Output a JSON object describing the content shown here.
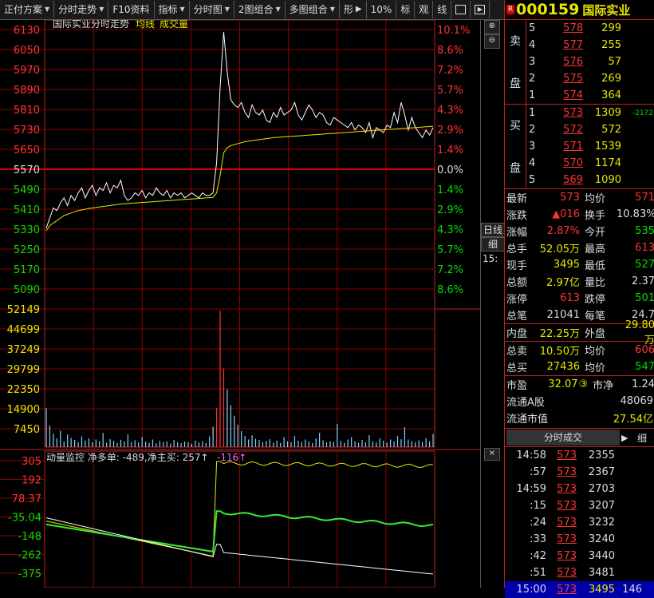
{
  "toolbar": {
    "buttons": [
      "正付方案",
      "分时走势",
      "F10资料",
      "指标",
      "分时图",
      "2图组合",
      "多图组合",
      "形"
    ],
    "small": [
      "10%",
      "标",
      "观",
      "线"
    ]
  },
  "chart": {
    "title": "国际实业分时走势",
    "legend_avg": "均线",
    "legend_vol": "成交量",
    "price_ticks": [
      "6130",
      "6050",
      "5970",
      "5890",
      "5810",
      "5730",
      "5650",
      "5570",
      "5490",
      "5410",
      "5330",
      "5250",
      "5170",
      "5090"
    ],
    "pct_ticks": [
      "10.1%",
      "8.6%",
      "7.2%",
      "5.7%",
      "4.3%",
      "2.9%",
      "1.4%",
      "0.0%",
      "1.4%",
      "2.9%",
      "4.3%",
      "5.7%",
      "7.2%",
      "8.6%"
    ],
    "vol_ticks": [
      "52149",
      "44699",
      "37249",
      "29799",
      "22350",
      "14900",
      "7450"
    ],
    "monitor_label": "动量监控 净多单: -489,净主买: 257↑",
    "monitor_val": "-116↑",
    "monitor_ticks": [
      "305",
      "192",
      "78.37",
      "-35.04",
      "-148",
      "-262",
      "-375"
    ],
    "side": {
      "daily": "日线",
      "detail": "细",
      "time": "15:"
    }
  },
  "chart_data": {
    "type": "line",
    "title": "国际实业分时走势",
    "ylim": [
      5050,
      6130
    ],
    "prev_close": 5570,
    "price": [
      5340,
      5380,
      5420,
      5410,
      5440,
      5460,
      5430,
      5470,
      5450,
      5480,
      5500,
      5460,
      5490,
      5510,
      5470,
      5500,
      5490,
      5520,
      5480,
      5510,
      5500,
      5530,
      5470,
      5450,
      5460,
      5480,
      5470,
      5490,
      5460,
      5480,
      5470,
      5500,
      5480,
      5470,
      5490,
      5460,
      5480,
      5470,
      5480,
      5460,
      5470,
      5480,
      5470,
      5460,
      5480,
      5470,
      5470,
      5480,
      5600,
      5900,
      6120,
      5960,
      5850,
      5830,
      5820,
      5840,
      5800,
      5780,
      5830,
      5800,
      5790,
      5810,
      5770,
      5760,
      5800,
      5780,
      5820,
      5790,
      5800,
      5810,
      5840,
      5790,
      5770,
      5800,
      5830,
      5810,
      5780,
      5800,
      5790,
      5760,
      5750,
      5780,
      5770,
      5760,
      5750,
      5740,
      5760,
      5730,
      5750,
      5740,
      5720,
      5760,
      5700,
      5740,
      5730,
      5720,
      5750,
      5740,
      5800,
      5760,
      5840,
      5790,
      5730,
      5780,
      5740,
      5720,
      5700,
      5730,
      5710,
      5740
    ],
    "avg": [
      5330,
      5350,
      5360,
      5370,
      5380,
      5390,
      5395,
      5400,
      5405,
      5410,
      5412,
      5415,
      5418,
      5420,
      5422,
      5424,
      5426,
      5428,
      5430,
      5432,
      5434,
      5436,
      5437,
      5438,
      5439,
      5440,
      5441,
      5442,
      5443,
      5444,
      5445,
      5446,
      5447,
      5448,
      5449,
      5450,
      5451,
      5452,
      5453,
      5454,
      5455,
      5456,
      5457,
      5458,
      5459,
      5460,
      5461,
      5462,
      5480,
      5550,
      5640,
      5660,
      5668,
      5672,
      5676,
      5680,
      5684,
      5686,
      5688,
      5690,
      5692,
      5694,
      5696,
      5698,
      5700,
      5701,
      5702,
      5703,
      5704,
      5705,
      5706,
      5707,
      5708,
      5709,
      5710,
      5711,
      5712,
      5713,
      5714,
      5715,
      5716,
      5717,
      5718,
      5719,
      5720,
      5721,
      5722,
      5723,
      5724,
      5725,
      5726,
      5727,
      5728,
      5729,
      5730,
      5731,
      5732,
      5733,
      5734,
      5735,
      5736,
      5737,
      5738,
      5739,
      5740,
      5741,
      5742,
      5743,
      5744,
      5745
    ],
    "volume": [
      14900,
      8200,
      5100,
      3300,
      6200,
      2100,
      4800,
      3500,
      2800,
      1900,
      4100,
      2500,
      3300,
      1800,
      2900,
      2200,
      5400,
      1700,
      3000,
      2400,
      1500,
      2800,
      2100,
      4900,
      1900,
      2600,
      1800,
      3900,
      2100,
      1600,
      2900,
      1500,
      2400,
      1900,
      2200,
      1300,
      2700,
      1800,
      1500,
      2100,
      1900,
      1300,
      2500,
      1800,
      2200,
      1600,
      4100,
      7800,
      14900,
      52149,
      30000,
      22000,
      16000,
      12000,
      8600,
      6100,
      4300,
      2900,
      4500,
      3200,
      2700,
      1900,
      2300,
      3000,
      1700,
      2500,
      1600,
      3800,
      2200,
      1900,
      4200,
      2400,
      1800,
      2900,
      2100,
      1600,
      3300,
      5400,
      2600,
      1800,
      2200,
      1900,
      8800,
      2400,
      1700,
      2900,
      3800,
      2200,
      1600,
      2700,
      1900,
      4600,
      2200,
      1800,
      3300,
      2400,
      1700,
      2900,
      2100,
      4200,
      3000,
      7600,
      2900,
      2300,
      1800,
      2600,
      1900,
      3400,
      2200,
      5000
    ]
  },
  "quote": {
    "code": "000159",
    "name": "国际实业",
    "badge": "R",
    "sell_label": [
      "卖",
      "盘"
    ],
    "buy_label": [
      "买",
      "盘"
    ],
    "asks": [
      {
        "lv": "5",
        "px": "578",
        "vol": "299"
      },
      {
        "lv": "4",
        "px": "577",
        "vol": "255"
      },
      {
        "lv": "3",
        "px": "576",
        "vol": "57"
      },
      {
        "lv": "2",
        "px": "575",
        "vol": "269"
      },
      {
        "lv": "1",
        "px": "574",
        "vol": "364"
      }
    ],
    "bids": [
      {
        "lv": "1",
        "px": "573",
        "vol": "1309",
        "chg": "-2172"
      },
      {
        "lv": "2",
        "px": "572",
        "vol": "572",
        "chg": ""
      },
      {
        "lv": "3",
        "px": "571",
        "vol": "1539",
        "chg": ""
      },
      {
        "lv": "4",
        "px": "570",
        "vol": "1174",
        "chg": ""
      },
      {
        "lv": "5",
        "px": "569",
        "vol": "1090",
        "chg": ""
      }
    ],
    "stats": [
      {
        "l": "最新",
        "v": "573",
        "vc": "red",
        "l2": "均价",
        "v2": "571",
        "v2c": "red"
      },
      {
        "l": "涨跌",
        "v": "▲016",
        "vc": "red",
        "l2": "换手",
        "v2": "10.83%",
        "v2c": "white"
      },
      {
        "l": "涨幅",
        "v": "2.87%",
        "vc": "red",
        "l2": "今开",
        "v2": "535",
        "v2c": "green"
      },
      {
        "l": "总手",
        "v": "52.05万",
        "vc": "yellow",
        "l2": "最高",
        "v2": "613",
        "v2c": "red"
      },
      {
        "l": "现手",
        "v": "3495",
        "vc": "yellow",
        "l2": "最低",
        "v2": "527",
        "v2c": "green"
      },
      {
        "l": "总额",
        "v": "2.97亿",
        "vc": "yellow",
        "l2": "量比",
        "v2": "2.37",
        "v2c": "white"
      },
      {
        "l": "涨停",
        "v": "613",
        "vc": "red",
        "l2": "跌停",
        "v2": "501",
        "v2c": "green"
      },
      {
        "l": "总笔",
        "v": "21041",
        "vc": "white",
        "l2": "每笔",
        "v2": "24.7",
        "v2c": "white"
      }
    ],
    "stats2": [
      {
        "l": "内盘",
        "v": "22.25万",
        "vc": "yellow",
        "l2": "外盘",
        "v2": "29.80万",
        "v2c": "yellow"
      }
    ],
    "stats3": [
      {
        "l": "总卖",
        "v": "10.50万",
        "vc": "yellow",
        "l2": "均价",
        "v2": "606",
        "v2c": "red"
      },
      {
        "l": "总买",
        "v": "27436",
        "vc": "yellow",
        "l2": "均价",
        "v2": "547",
        "v2c": "green"
      }
    ],
    "pe_label": "市盈",
    "pe": "32.07",
    "pe_badge": "③",
    "pb_label": "市净",
    "pb": "1.24",
    "float_label": "流通A股",
    "float": "48069",
    "mktcap_label": "流通市值",
    "mktcap": "27.54亿"
  },
  "ticks": {
    "title": "分时成交",
    "detail": "细",
    "rows": [
      {
        "t": "14:58",
        "p": "573",
        "v": "2355",
        "n": ""
      },
      {
        "t": ":57",
        "p": "573",
        "v": "2367",
        "n": ""
      },
      {
        "t": "14:59",
        "p": "573",
        "v": "2703",
        "n": ""
      },
      {
        "t": ":15",
        "p": "573",
        "v": "3207",
        "n": ""
      },
      {
        "t": ":24",
        "p": "573",
        "v": "3232",
        "n": ""
      },
      {
        "t": ":33",
        "p": "573",
        "v": "3240",
        "n": ""
      },
      {
        "t": ":42",
        "p": "573",
        "v": "3440",
        "n": ""
      },
      {
        "t": ":51",
        "p": "573",
        "v": "3481",
        "n": ""
      },
      {
        "t": "15:00",
        "p": "573",
        "v": "3495",
        "n": "146"
      }
    ]
  }
}
